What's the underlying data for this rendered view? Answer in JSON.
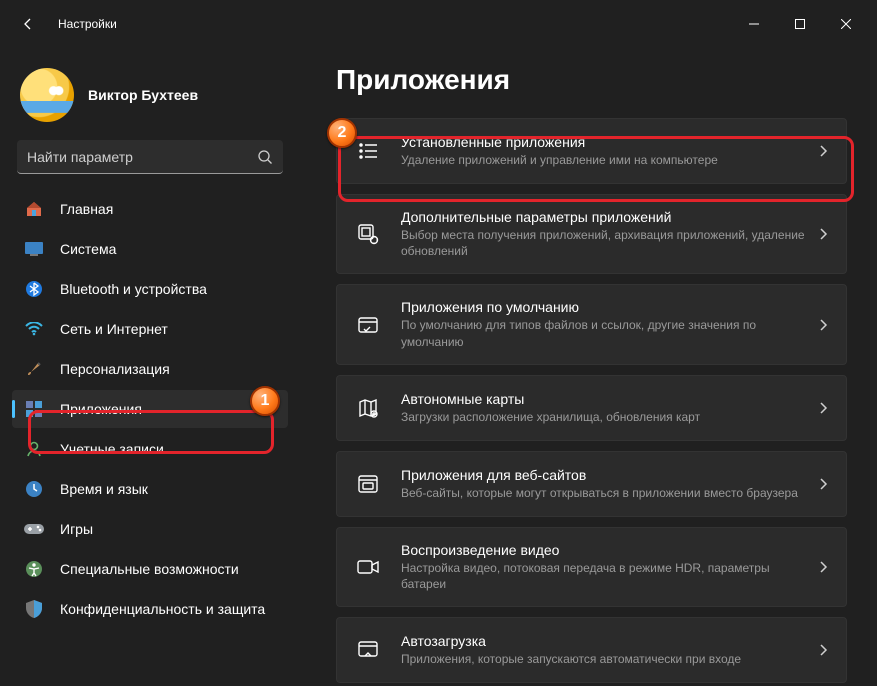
{
  "titlebar": {
    "title": "Настройки"
  },
  "profile": {
    "name": "Виктор Бухтеев",
    "sub": ""
  },
  "search": {
    "placeholder": "Найти параметр"
  },
  "sidebar": {
    "items": [
      {
        "label": "Главная"
      },
      {
        "label": "Система"
      },
      {
        "label": "Bluetooth и устройства"
      },
      {
        "label": "Сеть и Интернет"
      },
      {
        "label": "Персонализация"
      },
      {
        "label": "Приложения"
      },
      {
        "label": "Учетные записи"
      },
      {
        "label": "Время и язык"
      },
      {
        "label": "Игры"
      },
      {
        "label": "Специальные возможности"
      },
      {
        "label": "Конфиденциальность и защита"
      }
    ]
  },
  "page": {
    "title": "Приложения"
  },
  "cards": [
    {
      "title": "Установленные приложения",
      "sub": "Удаление приложений и управление ими на компьютере"
    },
    {
      "title": "Дополнительные параметры приложений",
      "sub": "Выбор места получения приложений, архивация приложений, удаление обновлений"
    },
    {
      "title": "Приложения по умолчанию",
      "sub": "По умолчанию для типов файлов и ссылок, другие значения по умолчанию"
    },
    {
      "title": "Автономные карты",
      "sub": "Загрузки расположение хранилища, обновления карт"
    },
    {
      "title": "Приложения для веб-сайтов",
      "sub": "Веб-сайты, которые могут открываться в приложении вместо браузера"
    },
    {
      "title": "Воспроизведение видео",
      "sub": "Настройка видео, потоковая передача в режиме HDR, параметры батареи"
    },
    {
      "title": "Автозагрузка",
      "sub": "Приложения, которые запускаются автоматически при входе"
    }
  ],
  "annotations": {
    "badge1": "1",
    "badge2": "2"
  }
}
